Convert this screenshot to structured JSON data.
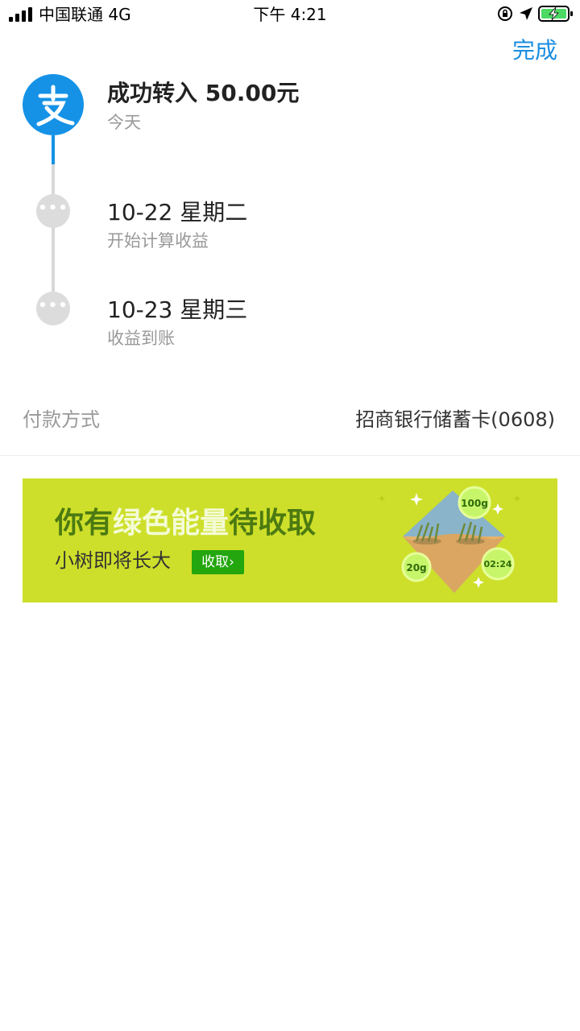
{
  "status_bar": {
    "carrier": "中国联通 4G",
    "time": "下午 4:21"
  },
  "header": {
    "done_label": "完成"
  },
  "timeline": {
    "steps": [
      {
        "title": "成功转入 50.00元",
        "subtitle": "今天"
      },
      {
        "title": "10-22 星期二",
        "subtitle": "开始计算收益"
      },
      {
        "title": "10-23 星期三",
        "subtitle": "收益到账"
      }
    ],
    "dots_glyph": "•••"
  },
  "payment": {
    "label": "付款方式",
    "value": "招商银行储蓄卡(0608)"
  },
  "banner": {
    "headline_part1": "你有",
    "headline_part2": "绿色能量",
    "headline_part3": "待收取",
    "subtitle": "小树即将长大",
    "button_label": "收取›",
    "bubble_1": "100g",
    "bubble_2": "20g",
    "bubble_3": "02:24"
  },
  "colors": {
    "accent_blue": "#1592e6",
    "link_blue": "#1b8ee0",
    "banner_bg": "#cddf2a",
    "banner_green_text": "#4c7a12",
    "button_green": "#23a60e"
  },
  "icons": [
    "signal-icon",
    "orientation-lock-icon",
    "location-arrow-icon",
    "battery-charging-icon",
    "alipay-logo-icon"
  ]
}
